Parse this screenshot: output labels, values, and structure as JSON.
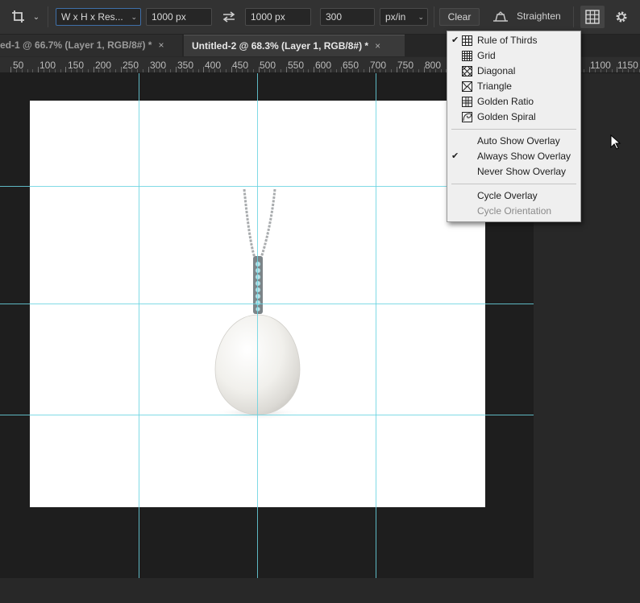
{
  "options_bar": {
    "crop_tool_icon": "crop-icon",
    "ratio_preset": "W x H x Res...",
    "width": "1000 px",
    "height": "1000 px",
    "resolution": "300",
    "resolution_unit": "px/in",
    "clear_label": "Clear",
    "straighten_label": "Straighten",
    "overlay_icon": "grid-icon",
    "settings_icon": "gear-icon"
  },
  "tabs": [
    {
      "label": "ed-1 @ 66.7% (Layer 1, RGB/8#) *",
      "close": "×",
      "active": false
    },
    {
      "label": "Untitled-2 @ 68.3% (Layer 1, RGB/8#) *",
      "close": "×",
      "active": true
    }
  ],
  "ruler": {
    "labels": [
      "50",
      "100",
      "150",
      "200",
      "250",
      "300",
      "350",
      "400",
      "450",
      "500",
      "550",
      "600",
      "650",
      "700",
      "750",
      "800",
      "1100",
      "1150"
    ]
  },
  "overlay_menu": {
    "overlay_types": [
      {
        "label": "Rule of Thirds",
        "checked": true,
        "icon": "rule-of-thirds-icon"
      },
      {
        "label": "Grid",
        "checked": false,
        "icon": "grid-icon"
      },
      {
        "label": "Diagonal",
        "checked": false,
        "icon": "diagonal-icon"
      },
      {
        "label": "Triangle",
        "checked": false,
        "icon": "triangle-icon"
      },
      {
        "label": "Golden Ratio",
        "checked": false,
        "icon": "golden-ratio-icon"
      },
      {
        "label": "Golden Spiral",
        "checked": false,
        "icon": "golden-spiral-icon"
      }
    ],
    "show_modes": [
      {
        "label": "Auto Show Overlay",
        "checked": false
      },
      {
        "label": "Always Show Overlay",
        "checked": true
      },
      {
        "label": "Never Show Overlay",
        "checked": false
      }
    ],
    "cycle": [
      {
        "label": "Cycle Overlay",
        "enabled": true
      },
      {
        "label": "Cycle Orientation",
        "enabled": false
      }
    ]
  },
  "colors": {
    "guide": "#6ad3e0",
    "pasteboard": "#1e1e1e",
    "panel": "#323232"
  }
}
